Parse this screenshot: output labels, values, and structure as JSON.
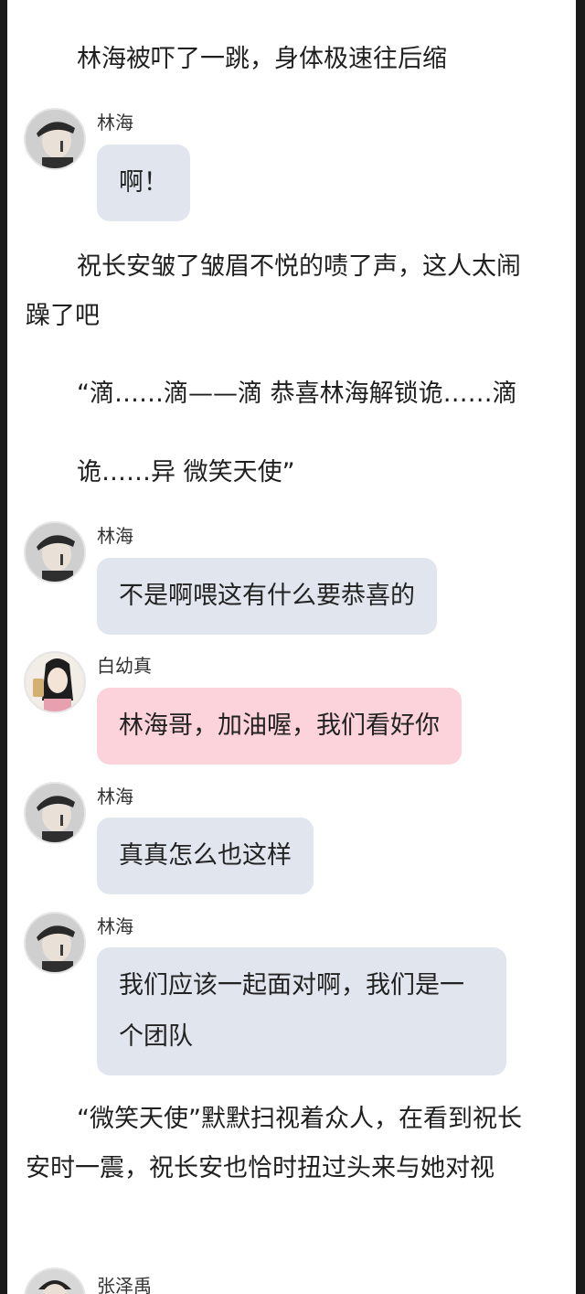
{
  "narration": {
    "p1": "林海被吓了一跳，身体极速往后缩",
    "p2": "祝长安皱了皱眉不悦的啧了声，这人太闹躁了吧",
    "p3": "“滴……滴——滴 恭喜林海解锁诡……滴",
    "p4": "诡……异 微笑天使”",
    "p5": "“微笑天使”默默扫视着众人，在看到祝长安时一震，祝长安也恰时扭过头来与她对视"
  },
  "messages": [
    {
      "sender": "林海",
      "text": "啊！"
    },
    {
      "sender": "林海",
      "text": "不是啊喂这有什么要恭喜的"
    },
    {
      "sender": "白幼真",
      "text": "林海哥，加油喔，我们看好你"
    },
    {
      "sender": "林海",
      "text": "真真怎么也这样"
    },
    {
      "sender": "林海",
      "text": "我们应该一起面对啊，我们是一个团队"
    },
    {
      "sender": "张泽禹",
      "text": ""
    }
  ],
  "colors": {
    "bubble_default": "#e1e6ee",
    "bubble_pink": "#fcd3da",
    "page_background": "#ffffff"
  },
  "icons": {
    "avatar_linhai": "avatar-boy-cap-icon",
    "avatar_baiyouzhen": "avatar-girl-selfie-icon",
    "avatar_zhangzeyu": "avatar-boy-icon"
  }
}
